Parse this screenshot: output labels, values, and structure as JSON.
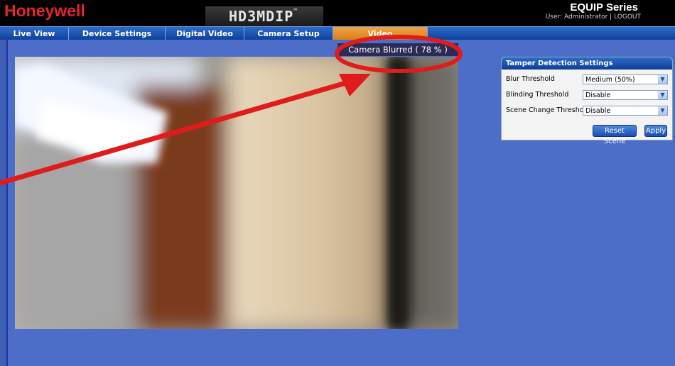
{
  "header": {
    "logo": "Honeywell",
    "model": "HD3MDIP",
    "model_tm": "™",
    "series": "EQUIP Series",
    "user_line": "User: Administrator | LOGOUT"
  },
  "nav": {
    "tabs": [
      {
        "label": "Live View"
      },
      {
        "label": "Device Settings"
      },
      {
        "label": "Digital Video"
      },
      {
        "label": "Camera Setup"
      },
      {
        "label": "Video"
      }
    ],
    "active_tab": "Video"
  },
  "status": {
    "message": "Camera Blurred ( 78 % )"
  },
  "tamper_panel": {
    "title": "Tamper Detection Settings",
    "rows": [
      {
        "label": "Blur Threshold",
        "value": "Medium (50%)"
      },
      {
        "label": "Blinding Threshold",
        "value": "Disable"
      },
      {
        "label": "Scene Change Threshold",
        "value": "Disable"
      }
    ],
    "reset_label": "Reset Scene",
    "apply_label": "Apply"
  },
  "colors": {
    "brand_red": "#e3262b",
    "nav_blue": "#1f56b5",
    "active_tab_orange": "#e8922a",
    "page_background": "#4d6ec8",
    "annotation_red": "#e01b1b"
  },
  "icons": {
    "dropdown": "chevron-down-icon"
  }
}
